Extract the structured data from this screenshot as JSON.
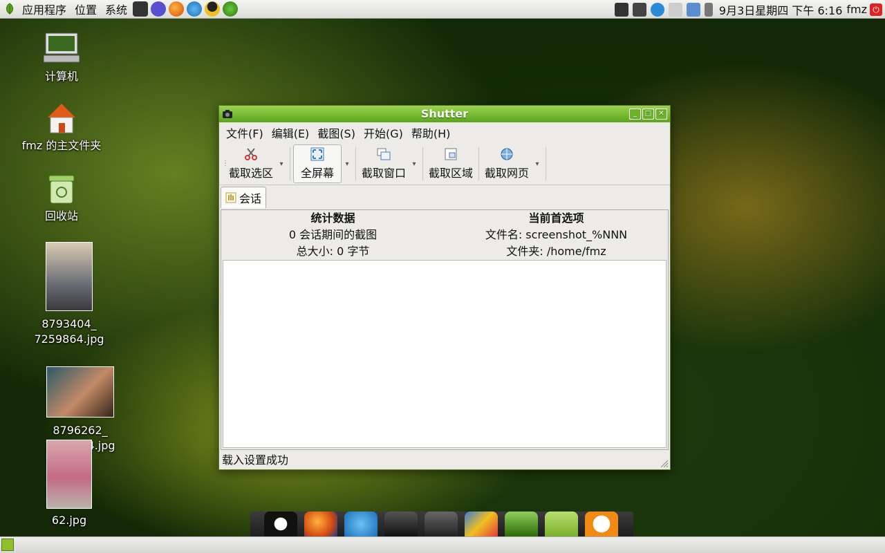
{
  "top_panel": {
    "menus": [
      "应用程序",
      "位置",
      "系统"
    ],
    "clock": "9月3日星期四 下午 6:16",
    "user": "fmz"
  },
  "desktop": {
    "icons": [
      {
        "label": "计算机"
      },
      {
        "label": "fmz 的主文件夹"
      },
      {
        "label": "回收站"
      },
      {
        "label": "8793404_\n7259864.jpg"
      },
      {
        "label": "8796262_\n7259864.jpg"
      },
      {
        "label": "62.jpg"
      }
    ]
  },
  "window": {
    "title": "Shutter",
    "menu": [
      "文件(F)",
      "编辑(E)",
      "截图(S)",
      "开始(G)",
      "帮助(H)"
    ],
    "toolbar": {
      "selection": "截取选区",
      "fullscreen": "全屏幕",
      "window": "截取窗口",
      "section": "截取区域",
      "web": "截取网页"
    },
    "tab": "会话",
    "stats": {
      "heading": "统计数据",
      "count": "0 会话期间的截图",
      "size": "总大小: 0 字节"
    },
    "prefs": {
      "heading": "当前首选项",
      "filename": "文件名: screenshot_%NNN",
      "folder": "文件夹: /home/fmz"
    },
    "status": "载入设置成功"
  },
  "colors": {
    "titlebar": "#6fbb2a",
    "desktop": "#2a4a12"
  }
}
